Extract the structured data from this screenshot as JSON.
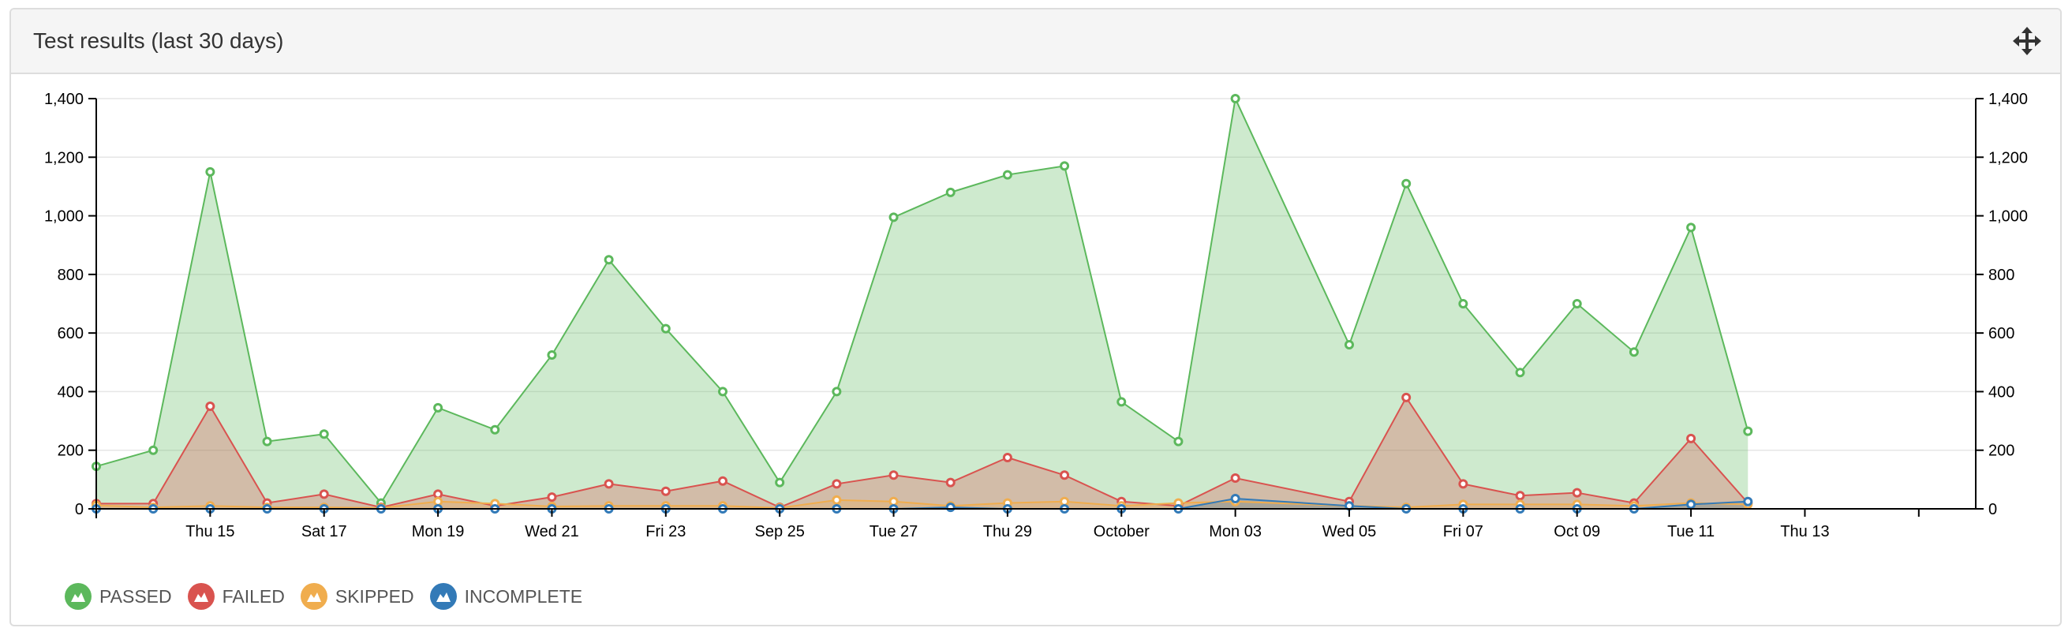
{
  "panel": {
    "title": "Test results (last 30 days)",
    "move_icon": "move-arrows-icon"
  },
  "colors": {
    "passed": "#5cb85c",
    "failed": "#d9534f",
    "skipped": "#f0ad4e",
    "incomplete": "#337ab7"
  },
  "chart_data": {
    "type": "area",
    "x": [
      1,
      2,
      3,
      4,
      5,
      6,
      7,
      8,
      9,
      10,
      11,
      12,
      13,
      14,
      15,
      16,
      17,
      18,
      19,
      20,
      21,
      23,
      24,
      25,
      26,
      27,
      28,
      29,
      30,
      32,
      33,
      34
    ],
    "x_tick_positions": [
      3,
      5,
      7,
      9,
      11,
      13,
      15,
      17,
      19,
      21,
      23,
      25,
      27,
      29,
      31,
      33
    ],
    "x_tick_labels": [
      "Thu 15",
      "Sat 17",
      "Mon 19",
      "Wed 21",
      "Fri 23",
      "Sep 25",
      "Tue 27",
      "Thu 29",
      "October",
      "Mon 03",
      "Wed 05",
      "Fri 07",
      "Oct 09",
      "Tue 11",
      "Thu 13"
    ],
    "ylim": [
      0,
      1400
    ],
    "y_ticks": [
      0,
      200,
      400,
      600,
      800,
      1000,
      1200,
      1400
    ],
    "y_tick_labels": [
      "0",
      "200",
      "400",
      "600",
      "800",
      "1,000",
      "1,200",
      "1,400"
    ],
    "series": [
      {
        "name": "PASSED",
        "color": "#5cb85c",
        "values": [
          145,
          200,
          1150,
          230,
          255,
          20,
          345,
          270,
          525,
          850,
          615,
          400,
          90,
          400,
          995,
          1080,
          1140,
          1170,
          365,
          230,
          1400,
          560,
          1110,
          700,
          465,
          700,
          535,
          960,
          265
        ]
      },
      {
        "name": "FAILED",
        "color": "#d9534f",
        "values": [
          18,
          18,
          350,
          20,
          50,
          5,
          50,
          10,
          40,
          85,
          60,
          95,
          5,
          85,
          115,
          90,
          175,
          115,
          25,
          10,
          105,
          25,
          380,
          85,
          45,
          55,
          20,
          240,
          20
        ]
      },
      {
        "name": "SKIPPED",
        "color": "#f0ad4e",
        "values": [
          12,
          5,
          10,
          5,
          5,
          3,
          25,
          18,
          8,
          10,
          10,
          10,
          3,
          30,
          25,
          10,
          20,
          25,
          10,
          20,
          25,
          10,
          5,
          15,
          15,
          15,
          10,
          20,
          15
        ]
      },
      {
        "name": "INCOMPLETE",
        "color": "#337ab7",
        "values": [
          0,
          0,
          0,
          0,
          0,
          0,
          0,
          0,
          0,
          0,
          0,
          0,
          0,
          0,
          0,
          5,
          0,
          0,
          0,
          0,
          35,
          10,
          0,
          0,
          0,
          0,
          0,
          15,
          25
        ]
      }
    ]
  },
  "legend": [
    {
      "label": "PASSED",
      "color": "#5cb85c"
    },
    {
      "label": "FAILED",
      "color": "#d9534f"
    },
    {
      "label": "SKIPPED",
      "color": "#f0ad4e"
    },
    {
      "label": "INCOMPLETE",
      "color": "#337ab7"
    }
  ]
}
